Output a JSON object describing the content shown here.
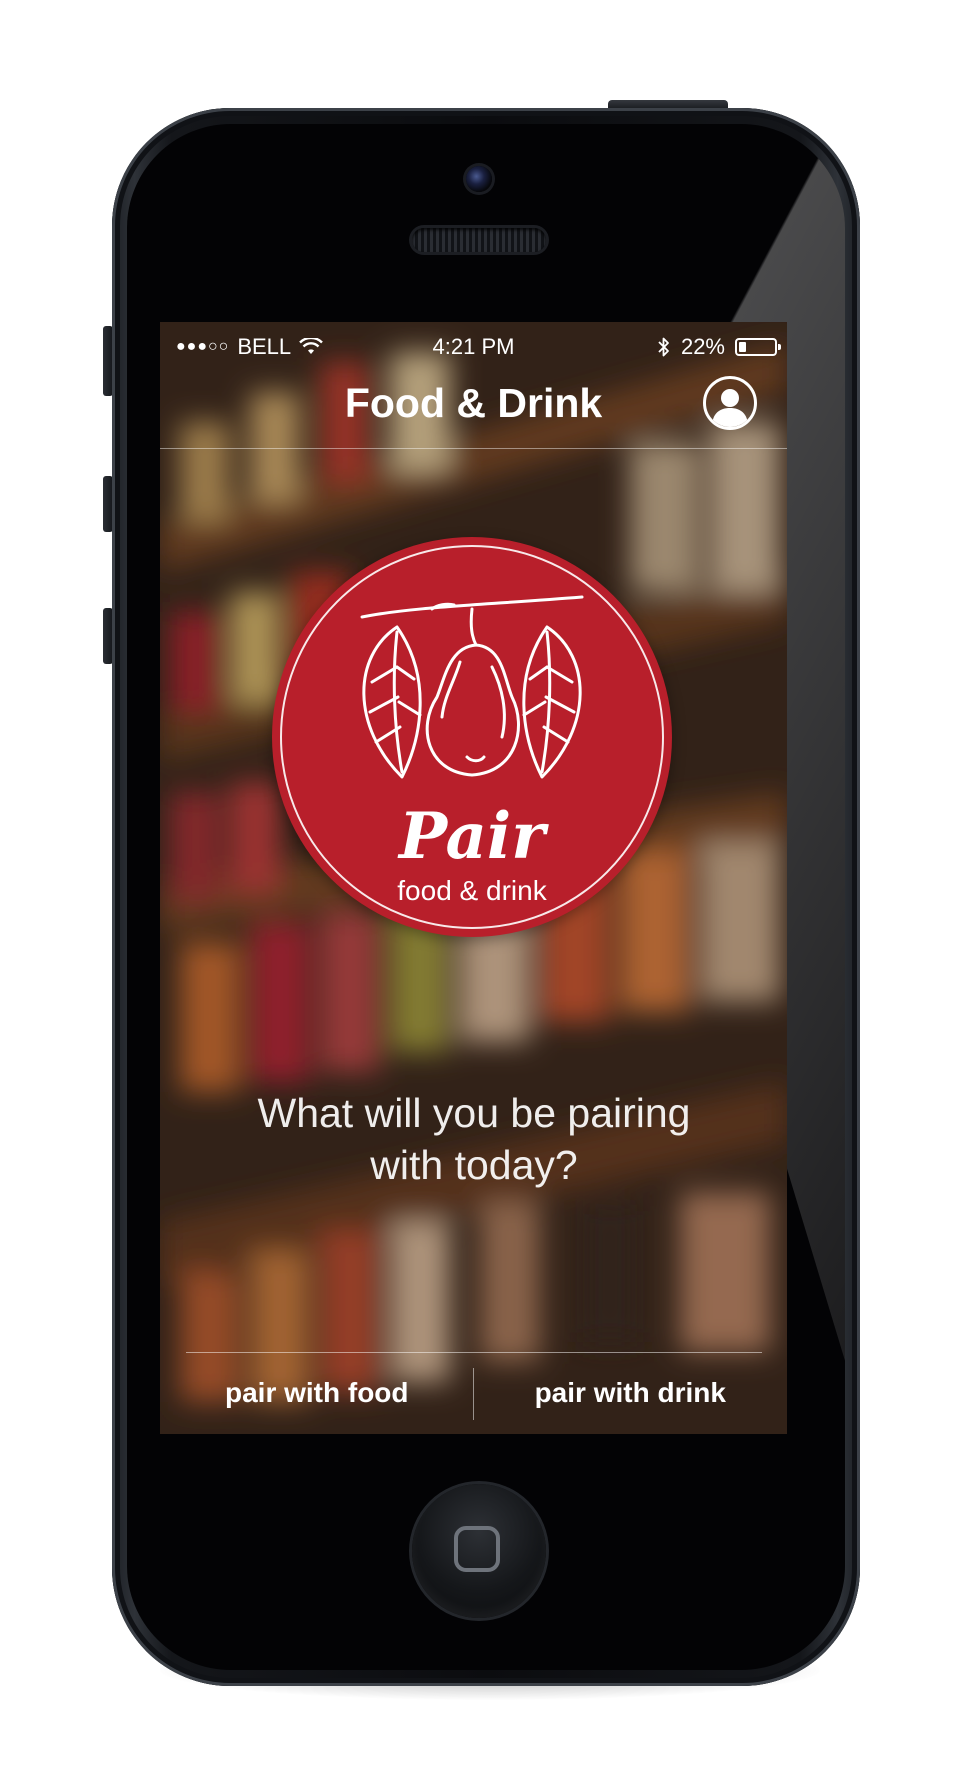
{
  "status_bar": {
    "signal": "●●●○○",
    "carrier": "BELL",
    "time": "4:21 PM",
    "battery": "22%",
    "battery_level": 0.22
  },
  "nav": {
    "title": "Food & Drink"
  },
  "logo": {
    "title": "Pair",
    "subtitle": "food & drink",
    "color": "#b81f2b"
  },
  "prompt": {
    "line1": "What will you be pairing",
    "line2": "with today?"
  },
  "actions": {
    "food_label": "pair with food",
    "drink_label": "pair with drink"
  }
}
